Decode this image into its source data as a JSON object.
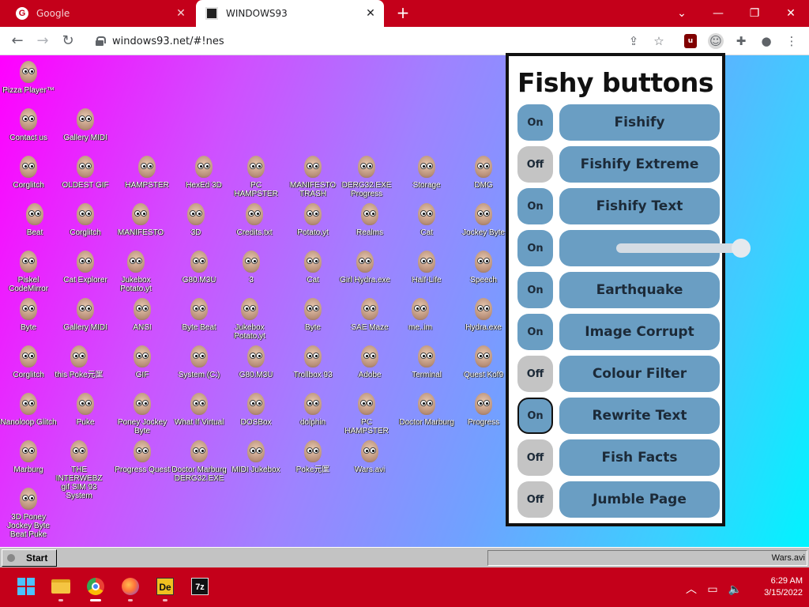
{
  "browser": {
    "tabs": [
      {
        "title": "Google",
        "active": false
      },
      {
        "title": "WINDOWS93",
        "active": true
      }
    ],
    "url": "windows93.net/#!nes"
  },
  "desktop_icons": [
    {
      "label": "Pizza Player™"
    },
    {
      "label": "Contact us"
    },
    {
      "label": "Gallery MIDI"
    },
    {
      "label": "Corglitch"
    },
    {
      "label": "OLDEST GIF"
    },
    {
      "label": "HAMPSTER"
    },
    {
      "label": "HexEd 3D"
    },
    {
      "label": "PC HAMPSTER"
    },
    {
      "label": "MANIFESTO TRASH"
    },
    {
      "label": "DERG32.EXE Progress"
    },
    {
      "label": "Storage"
    },
    {
      "label": "DMG"
    },
    {
      "label": "Beat"
    },
    {
      "label": "Corglitch"
    },
    {
      "label": "MANIFESTO"
    },
    {
      "label": "3D"
    },
    {
      "label": "Credits.txt"
    },
    {
      "label": "Potato.yt"
    },
    {
      "label": "Realms"
    },
    {
      "label": "Cat"
    },
    {
      "label": "Jockey Byte"
    },
    {
      "label": "Piskel CodeMirror"
    },
    {
      "label": "Cat Explorer"
    },
    {
      "label": "Jukebox Potato.yt"
    },
    {
      "label": "G80.M3U"
    },
    {
      "label": "3"
    },
    {
      "label": "Cat"
    },
    {
      "label": "Girl Hydra.exe"
    },
    {
      "label": "Half-Life"
    },
    {
      "label": "Speech"
    },
    {
      "label": "Byte"
    },
    {
      "label": "Gallery MIDI"
    },
    {
      "label": "ANSI"
    },
    {
      "label": "Byte Beat"
    },
    {
      "label": "Jukebox Potato.yt"
    },
    {
      "label": "Byte"
    },
    {
      "label": "SAE Maze"
    },
    {
      "label": "me..im"
    },
    {
      "label": "Hydra.exe"
    },
    {
      "label": "Corglitch"
    },
    {
      "label": "this Poke元匩"
    },
    {
      "label": "GIF"
    },
    {
      "label": "System (C:)"
    },
    {
      "label": "G80.M3U"
    },
    {
      "label": "Trollbox 93"
    },
    {
      "label": "Adobe"
    },
    {
      "label": "Terminal"
    },
    {
      "label": "Quest Kof9"
    },
    {
      "label": "Nanoloop Glitch"
    },
    {
      "label": "Puke"
    },
    {
      "label": "Poney Jockey Byte"
    },
    {
      "label": "What If Virtual"
    },
    {
      "label": "DOSBox"
    },
    {
      "label": "dolphin"
    },
    {
      "label": "PC HAMPSTER"
    },
    {
      "label": "Doctor Marburg"
    },
    {
      "label": "Progress"
    },
    {
      "label": "Marburg"
    },
    {
      "label": "THE INTERWEBZ gif SIM 93 System"
    },
    {
      "label": "Progress Quest"
    },
    {
      "label": "Doctor Marburg DERG32.EXE"
    },
    {
      "label": "MIDI Jukebox"
    },
    {
      "label": "Poke元匩"
    },
    {
      "label": "Wars.avi"
    },
    {
      "label": "3D Poney Jockey Byte Beat Puke"
    }
  ],
  "fishy_panel": {
    "title": "Fishy buttons",
    "rows": [
      {
        "toggle": "On",
        "state": "on",
        "label": "Fishify"
      },
      {
        "toggle": "Off",
        "state": "off",
        "label": "Fishify Extreme"
      },
      {
        "toggle": "On",
        "state": "on",
        "label": "Fishify Text"
      },
      {
        "toggle": "On",
        "state": "on",
        "label": "",
        "slider_value": 1.0
      },
      {
        "toggle": "On",
        "state": "on",
        "label": "Earthquake"
      },
      {
        "toggle": "On",
        "state": "on",
        "label": "Image Corrupt"
      },
      {
        "toggle": "Off",
        "state": "off",
        "label": "Colour Filter"
      },
      {
        "toggle": "On",
        "state": "on",
        "label": "Rewrite Text",
        "focused": true
      },
      {
        "toggle": "Off",
        "state": "off",
        "label": "Fish Facts"
      },
      {
        "toggle": "Off",
        "state": "off",
        "label": "Jumble Page"
      }
    ]
  },
  "w93_taskbar": {
    "start_label": "Start",
    "tray_text": "Wars.avi"
  },
  "windows_taskbar": {
    "apps": [
      "windows-start",
      "file-explorer",
      "chrome",
      "firefox",
      "dev-app",
      "7zip"
    ],
    "time": "6:29 AM",
    "date": "3/15/2022"
  },
  "colors": {
    "button_blue": "#6a9ec3",
    "toggle_off": "#c4c4c4",
    "chrome_red": "#c4001a"
  }
}
